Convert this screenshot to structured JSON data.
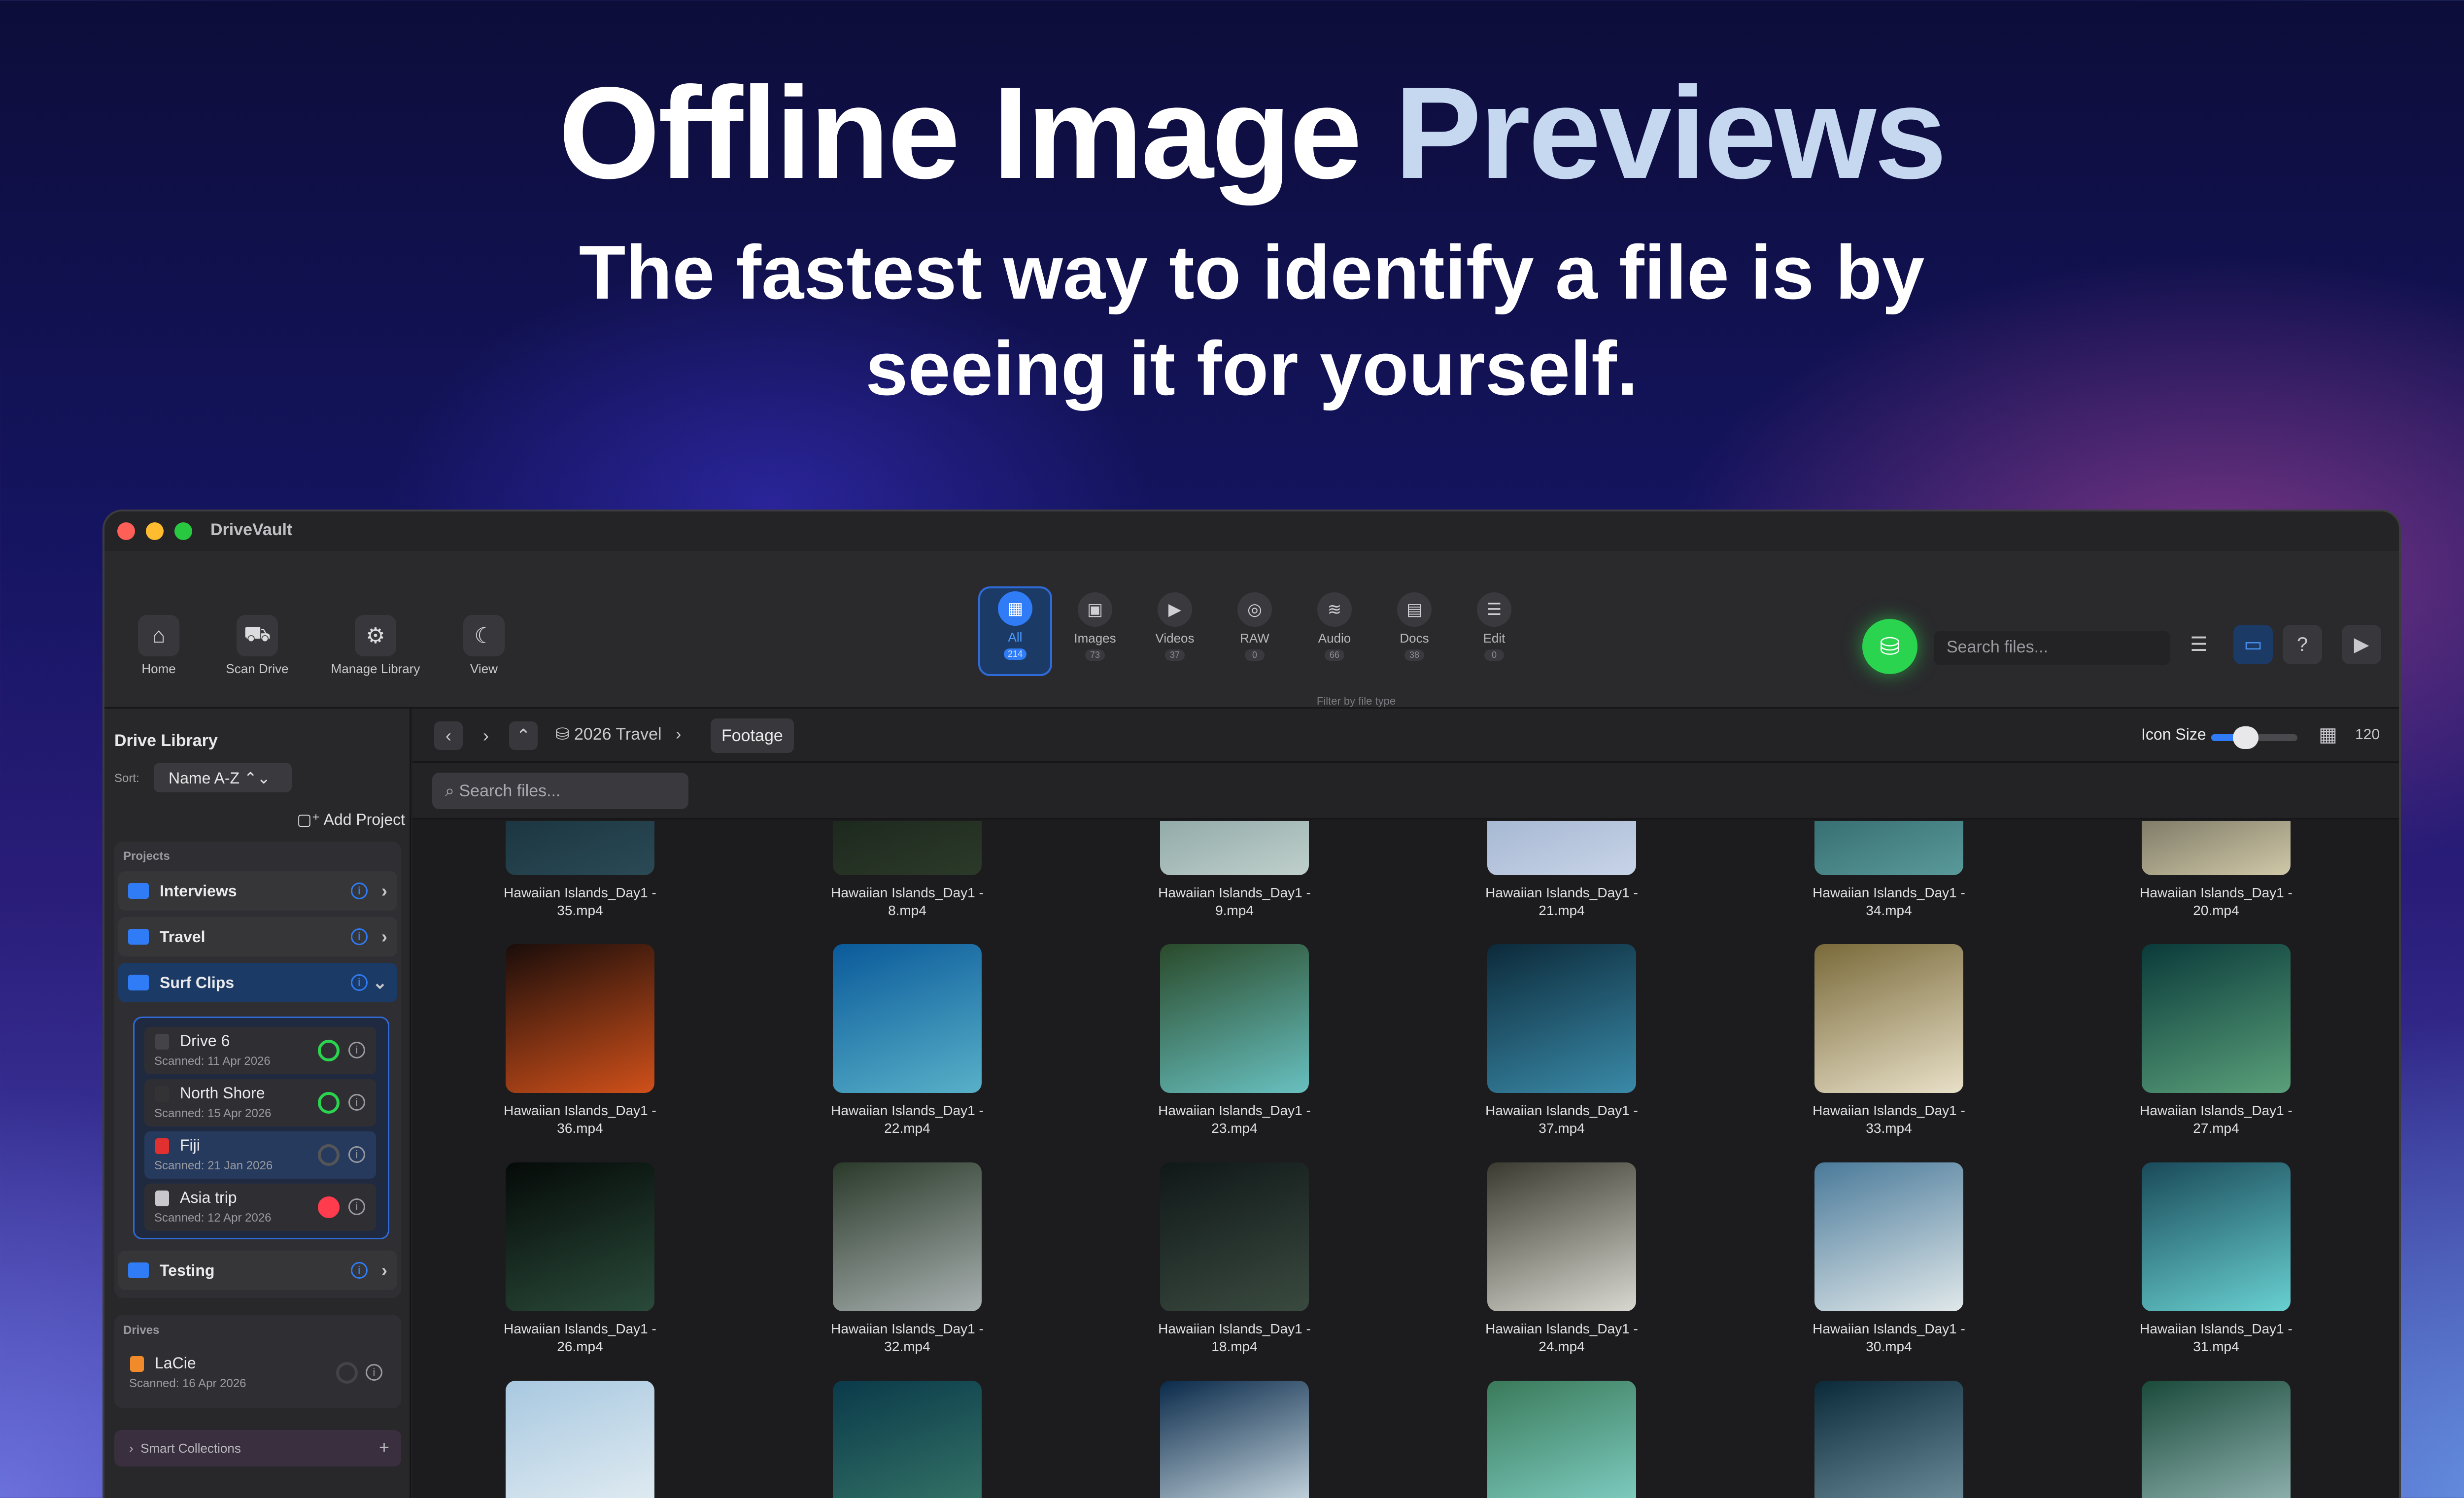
{
  "hero": {
    "title_part1": "Offline Image",
    "title_part2": "Previews",
    "subtitle_line1": "The fastest way to identify a file is by",
    "subtitle_line2": "seeing it for yourself."
  },
  "window": {
    "title": "DriveVault",
    "traffic_lights": [
      "#ff5f57",
      "#febc2e",
      "#28c840"
    ]
  },
  "toolbar": {
    "buttons": [
      {
        "label": "Home",
        "icon": "⌂"
      },
      {
        "label": "Scan Drive",
        "icon": "⛟"
      },
      {
        "label": "Manage Library",
        "icon": "⚙"
      },
      {
        "label": "View",
        "icon": "☾"
      }
    ],
    "filters": [
      {
        "label": "All",
        "count": "214",
        "icon": "▦"
      },
      {
        "label": "Images",
        "count": "73",
        "icon": "▣"
      },
      {
        "label": "Videos",
        "count": "37",
        "icon": "▶"
      },
      {
        "label": "RAW",
        "count": "0",
        "icon": "◎"
      },
      {
        "label": "Audio",
        "count": "66",
        "icon": "≋"
      },
      {
        "label": "Docs",
        "count": "38",
        "icon": "▤"
      },
      {
        "label": "Edit",
        "count": "0",
        "icon": "☰"
      }
    ],
    "filter_caption": "Filter by file type",
    "search_placeholder": "Search files...",
    "green_icon": "⛁",
    "right_icons": [
      "☰",
      "▭",
      "?",
      "▶"
    ]
  },
  "sidebar": {
    "title": "Drive Library",
    "sort_label": "Sort:",
    "sort_value": "Name A-Z ⌃⌄",
    "add_project": "Add Project",
    "projects_label": "Projects",
    "projects": [
      {
        "name": "Interviews"
      },
      {
        "name": "Travel"
      },
      {
        "name": "Surf Clips"
      },
      {
        "name": "Testing"
      }
    ],
    "surf_drives": [
      {
        "name": "Drive 6",
        "scanned": "Scanned: 11 Apr 2026",
        "icon_color": "#444448",
        "ring": "#2bd44f"
      },
      {
        "name": "North Shore",
        "scanned": "Scanned: 15 Apr 2026",
        "icon_color": "#333336",
        "ring": "#2bd44f"
      },
      {
        "name": "Fiji",
        "scanned": "Scanned: 21 Jan 2026",
        "icon_color": "#e03030",
        "ring": "#555558"
      },
      {
        "name": "Asia trip",
        "scanned": "Scanned: 12 Apr 2026",
        "icon_color": "#c8c8cc",
        "ring": "#ff3b4e"
      }
    ],
    "drives_label": "Drives",
    "drives": [
      {
        "name": "LaCie",
        "scanned": "Scanned: 16 Apr 2026",
        "icon_color": "#f08a2a"
      }
    ],
    "smart_collections": "Smart Collections"
  },
  "main": {
    "breadcrumb_root": "2026 Travel",
    "breadcrumb_current": "Footage",
    "icon_size_label": "Icon Size",
    "icon_size_value": "120",
    "icon_size_fraction": 0.4,
    "search_placeholder": "Search files...",
    "files": [
      {
        "name": "Hawaiian Islands_Day1 -",
        "ext": "35.mp4",
        "colors": [
          "#10252e",
          "#2a4a56"
        ]
      },
      {
        "name": "Hawaiian Islands_Day1 -",
        "ext": "8.mp4",
        "colors": [
          "#0f1a12",
          "#2c3a2a"
        ]
      },
      {
        "name": "Hawaiian Islands_Day1 -",
        "ext": "9.mp4",
        "colors": [
          "#6a8a8a",
          "#c0d0cc"
        ]
      },
      {
        "name": "Hawaiian Islands_Day1 -",
        "ext": "21.mp4",
        "colors": [
          "#8aa0c0",
          "#c8d4e8"
        ]
      },
      {
        "name": "Hawaiian Islands_Day1 -",
        "ext": "34.mp4",
        "colors": [
          "#1a4a50",
          "#5a9a9a"
        ]
      },
      {
        "name": "Hawaiian Islands_Day1 -",
        "ext": "20.mp4",
        "colors": [
          "#3a3a30",
          "#d0c8a8"
        ]
      },
      {
        "name": "Hawaiian Islands_Day1 -",
        "ext": "36.mp4",
        "colors": [
          "#1a0d0a",
          "#d0501a"
        ]
      },
      {
        "name": "Hawaiian Islands_Day1 -",
        "ext": "22.mp4",
        "colors": [
          "#0a5a9a",
          "#58b0c8"
        ]
      },
      {
        "name": "Hawaiian Islands_Day1 -",
        "ext": "23.mp4",
        "colors": [
          "#2a4a2a",
          "#68c0c0"
        ]
      },
      {
        "name": "Hawaiian Islands_Day1 -",
        "ext": "37.mp4",
        "colors": [
          "#0c2a3a",
          "#3a8aa8"
        ]
      },
      {
        "name": "Hawaiian Islands_Day1 -",
        "ext": "33.mp4",
        "colors": [
          "#7a6a3a",
          "#e8e0c8"
        ]
      },
      {
        "name": "Hawaiian Islands_Day1 -",
        "ext": "27.mp4",
        "colors": [
          "#0a3a3a",
          "#5aa07a"
        ]
      },
      {
        "name": "Hawaiian Islands_Day1 -",
        "ext": "26.mp4",
        "colors": [
          "#050a08",
          "#2a4a3a"
        ]
      },
      {
        "name": "Hawaiian Islands_Day1 -",
        "ext": "32.mp4",
        "colors": [
          "#2a3a2a",
          "#a8b0b0"
        ]
      },
      {
        "name": "Hawaiian Islands_Day1 -",
        "ext": "18.mp4",
        "colors": [
          "#101818",
          "#3a4a40"
        ]
      },
      {
        "name": "Hawaiian Islands_Day1 -",
        "ext": "24.mp4",
        "colors": [
          "#3a3a30",
          "#d8d8d0"
        ]
      },
      {
        "name": "Hawaiian Islands_Day1 -",
        "ext": "30.mp4",
        "colors": [
          "#4a7a9a",
          "#e0e8ea"
        ]
      },
      {
        "name": "Hawaiian Islands_Day1 -",
        "ext": "31.mp4",
        "colors": [
          "#1a4a5a",
          "#68d0d0"
        ]
      },
      {
        "name": "",
        "ext": "",
        "colors": [
          "#a8c8e0",
          "#e8f0f4"
        ]
      },
      {
        "name": "",
        "ext": "",
        "colors": [
          "#0a3a4a",
          "#3a7a6a"
        ]
      },
      {
        "name": "",
        "ext": "",
        "colors": [
          "#0a2a4a",
          "#e0eef4"
        ]
      },
      {
        "name": "",
        "ext": "",
        "colors": [
          "#3a7a5a",
          "#88d8d0"
        ]
      },
      {
        "name": "",
        "ext": "",
        "colors": [
          "#0a2a3a",
          "#7a9aa8"
        ]
      },
      {
        "name": "",
        "ext": "",
        "colors": [
          "#1a4a3a",
          "#a0c0c0"
        ]
      }
    ]
  }
}
